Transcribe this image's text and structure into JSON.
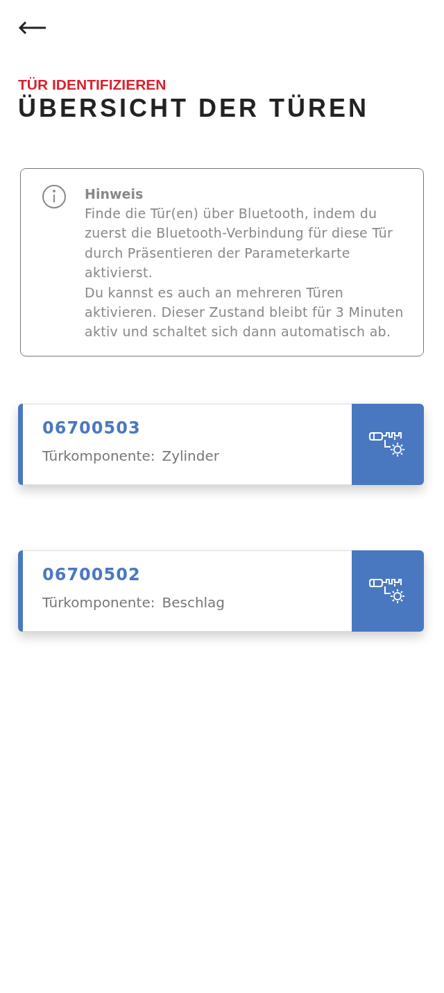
{
  "header": {
    "subtitle": "TÜR IDENTIFIZIEREN",
    "title": "ÜBERSICHT DER TÜREN"
  },
  "notice": {
    "title": "Hinweis",
    "paragraphs": [
      "Finde die Tür(en) über Bluetooth, indem du zuerst die Bluetooth-Verbindung für diese Tür durch Präsentieren der Parameterkarte aktivierst.",
      "Du kannst es auch an mehreren Türen aktivieren. Dieser Zustand bleibt für 3 Minuten aktiv und schaltet sich dann automatisch ab."
    ]
  },
  "doors": [
    {
      "number": "06700503",
      "label": "Türkomponente:",
      "component": "Zylinder"
    },
    {
      "number": "06700502",
      "label": "Türkomponente:",
      "component": "Beschlag"
    }
  ]
}
